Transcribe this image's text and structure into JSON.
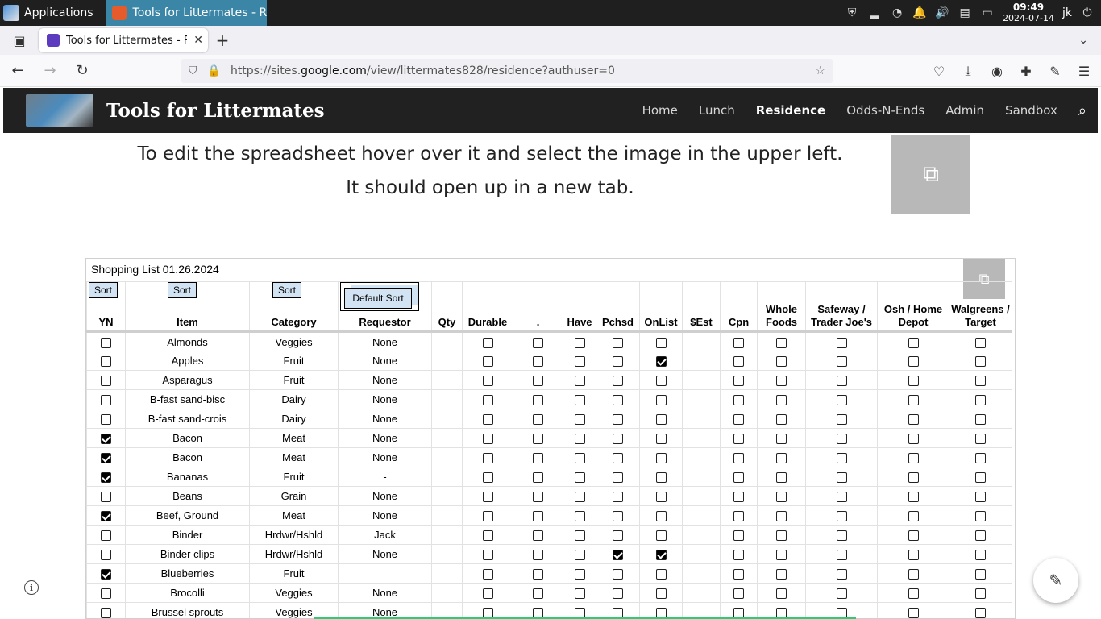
{
  "taskbar": {
    "apps_label": "Applications",
    "task_title": "Tools for Littermates - Resi...",
    "clock_time": "09:49",
    "clock_date": "2024-07-14",
    "user": "jk"
  },
  "browser": {
    "tab_title": "Tools for Littermates - Resic",
    "url_prefix": "https://sites.",
    "url_domain": "google.com",
    "url_path": "/view/littermates828/residence?authuser=0"
  },
  "site": {
    "title": "Tools for Littermates",
    "nav": [
      "Home",
      "Lunch",
      "Residence",
      "Odds-N-Ends",
      "Admin",
      "Sandbox"
    ],
    "active_nav": "Residence"
  },
  "content": {
    "instruction_line1": "To edit the spreadsheet hover over it and select the image in the upper left.",
    "instruction_line2": "It should open up in a new tab."
  },
  "sheet": {
    "title": "Shopping List 01.26.2024",
    "sort_label": "Sort",
    "default_sort_label": "Default Sort",
    "headers": [
      "YN",
      "Item",
      "Category",
      "Requestor",
      "Qty",
      "Durable",
      ".",
      "Have",
      "Pchsd",
      "OnList",
      "$Est",
      "Cpn",
      "Whole Foods",
      "Safeway / Trader Joe's",
      "Osh / Home Depot",
      "Walgreens / Target"
    ],
    "rows": [
      {
        "yn": false,
        "item": "Almonds",
        "category": "Veggies",
        "requestor": "None",
        "pchsd": false,
        "onlist": false
      },
      {
        "yn": false,
        "item": "Apples",
        "category": "Fruit",
        "requestor": "None",
        "pchsd": false,
        "onlist": true
      },
      {
        "yn": false,
        "item": "Asparagus",
        "category": "Fruit",
        "requestor": "None",
        "pchsd": false,
        "onlist": false
      },
      {
        "yn": false,
        "item": "B-fast sand-bisc",
        "category": "Dairy",
        "requestor": "None",
        "pchsd": false,
        "onlist": false
      },
      {
        "yn": false,
        "item": "B-fast sand-crois",
        "category": "Dairy",
        "requestor": "None",
        "pchsd": false,
        "onlist": false
      },
      {
        "yn": true,
        "item": "Bacon",
        "category": "Meat",
        "requestor": "None",
        "pchsd": false,
        "onlist": false
      },
      {
        "yn": true,
        "item": "Bacon",
        "category": "Meat",
        "requestor": "None",
        "pchsd": false,
        "onlist": false
      },
      {
        "yn": true,
        "item": "Bananas",
        "category": "Fruit",
        "requestor": "-",
        "pchsd": false,
        "onlist": false
      },
      {
        "yn": false,
        "item": "Beans",
        "category": "Grain",
        "requestor": "None",
        "pchsd": false,
        "onlist": false
      },
      {
        "yn": true,
        "item": "Beef, Ground",
        "category": "Meat",
        "requestor": "None",
        "pchsd": false,
        "onlist": false
      },
      {
        "yn": false,
        "item": "Binder",
        "category": "Hrdwr/Hshld",
        "requestor": "Jack",
        "pchsd": false,
        "onlist": false
      },
      {
        "yn": false,
        "item": "Binder clips",
        "category": "Hrdwr/Hshld",
        "requestor": "None",
        "pchsd": true,
        "onlist": true
      },
      {
        "yn": true,
        "item": "Blueberries",
        "category": "Fruit",
        "requestor": "",
        "pchsd": false,
        "onlist": false
      },
      {
        "yn": false,
        "item": "Brocolli",
        "category": "Veggies",
        "requestor": "None",
        "pchsd": false,
        "onlist": false
      },
      {
        "yn": false,
        "item": "Brussel sprouts",
        "category": "Veggies",
        "requestor": "None",
        "pchsd": false,
        "onlist": false
      }
    ]
  }
}
